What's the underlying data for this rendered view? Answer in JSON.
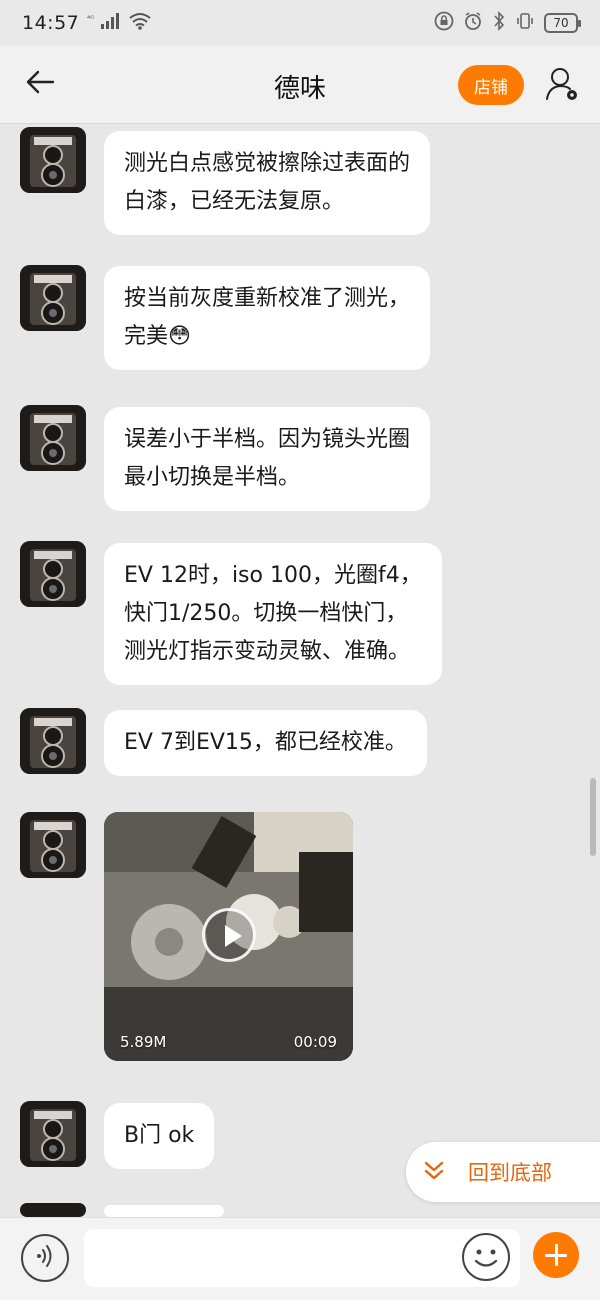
{
  "status_bar": {
    "time": "14:57",
    "signal": "⁴ᴳ",
    "battery": "70"
  },
  "header": {
    "title": "德味",
    "shop_label": "店铺"
  },
  "colors": {
    "accent": "#ff7a00",
    "bubble": "#ffffff",
    "background": "#e7e7e7"
  },
  "messages": [
    {
      "type": "text",
      "text": "测光白点感觉被擦除过表面的\n白漆，已经无法复原。"
    },
    {
      "type": "text",
      "text": "按当前灰度重新校准了测光，\n完美😳"
    },
    {
      "type": "text",
      "text": "误差小于半档。因为镜头光圈\n最小切换是半档。"
    },
    {
      "type": "text",
      "text": "EV 12时，iso 100，光圈f4，\n快门1/250。切换一档快门，\n测光灯指示变动灵敏、准确。"
    },
    {
      "type": "text",
      "text": "EV 7到EV15，都已经校准。"
    },
    {
      "type": "video",
      "size": "5.89M",
      "duration": "00:09"
    },
    {
      "type": "text",
      "text": "B门 ok"
    }
  ],
  "back_to_bottom": {
    "label": "回到底部",
    "icon": "double-chevron-down-icon"
  },
  "input_bar": {
    "placeholder": "",
    "icons": [
      "voice-icon",
      "emoji-icon",
      "plus-icon"
    ]
  }
}
